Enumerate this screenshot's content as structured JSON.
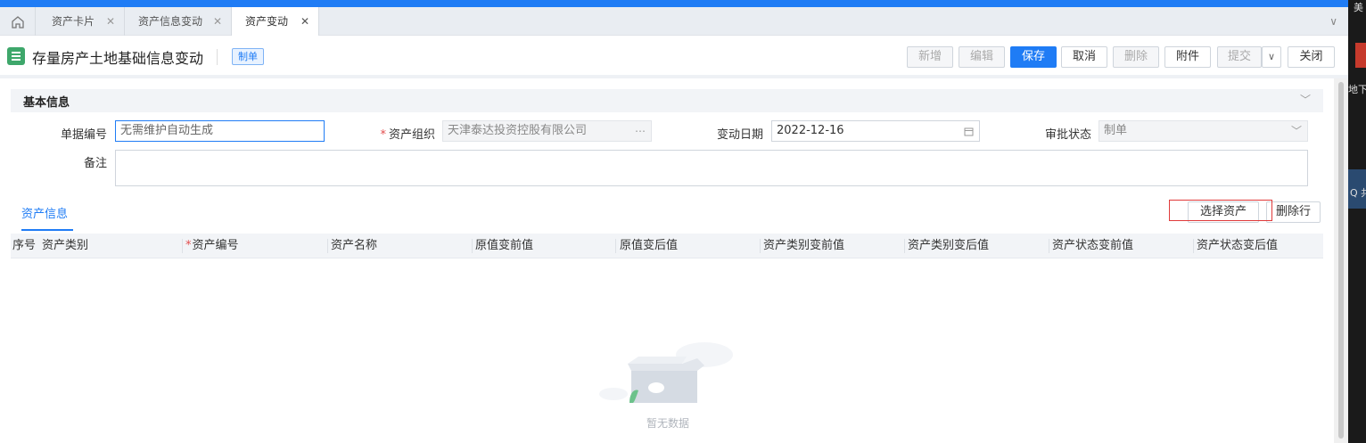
{
  "tabs": [
    {
      "label": "资产卡片"
    },
    {
      "label": "资产信息变动"
    },
    {
      "label": "资产变动"
    }
  ],
  "tabs_more": "∨",
  "header": {
    "title": "存量房产土地基础信息变动",
    "status_badge": "制单"
  },
  "toolbar": {
    "add": "新增",
    "edit": "编辑",
    "save": "保存",
    "cancel": "取消",
    "delete": "删除",
    "attach": "附件",
    "submit": "提交",
    "submit_more": "∨",
    "close": "关闭"
  },
  "basic_info": {
    "section_title": "基本信息",
    "doc_no_label": "单据编号",
    "doc_no_placeholder": "无需维护自动生成",
    "org_label": "资产组织",
    "org_value": "天津泰达投资控股有限公司",
    "date_label": "变动日期",
    "date_value": "2022-12-16",
    "approval_label": "审批状态",
    "approval_value": "制单",
    "remark_label": "备注"
  },
  "asset_info": {
    "tab_label": "资产信息",
    "select_asset": "选择资产",
    "delete_row": "删除行",
    "columns": [
      "序号",
      "资产类别",
      "资产编号",
      "资产名称",
      "原值变前值",
      "原值变后值",
      "资产类别变前值",
      "资产类别变后值",
      "资产状态变前值",
      "资产状态变后值"
    ],
    "empty_text": "暂无数据"
  },
  "right_strip": {
    "t1": "美",
    "t2": "地下",
    "t3": "Q 共"
  },
  "colors": {
    "accent": "#1f7cf5",
    "top_bar": "#1f7cf5",
    "doc_icon": "#3ea76b",
    "required": "#e34d4d",
    "highlight_box": "#e03a3a"
  }
}
